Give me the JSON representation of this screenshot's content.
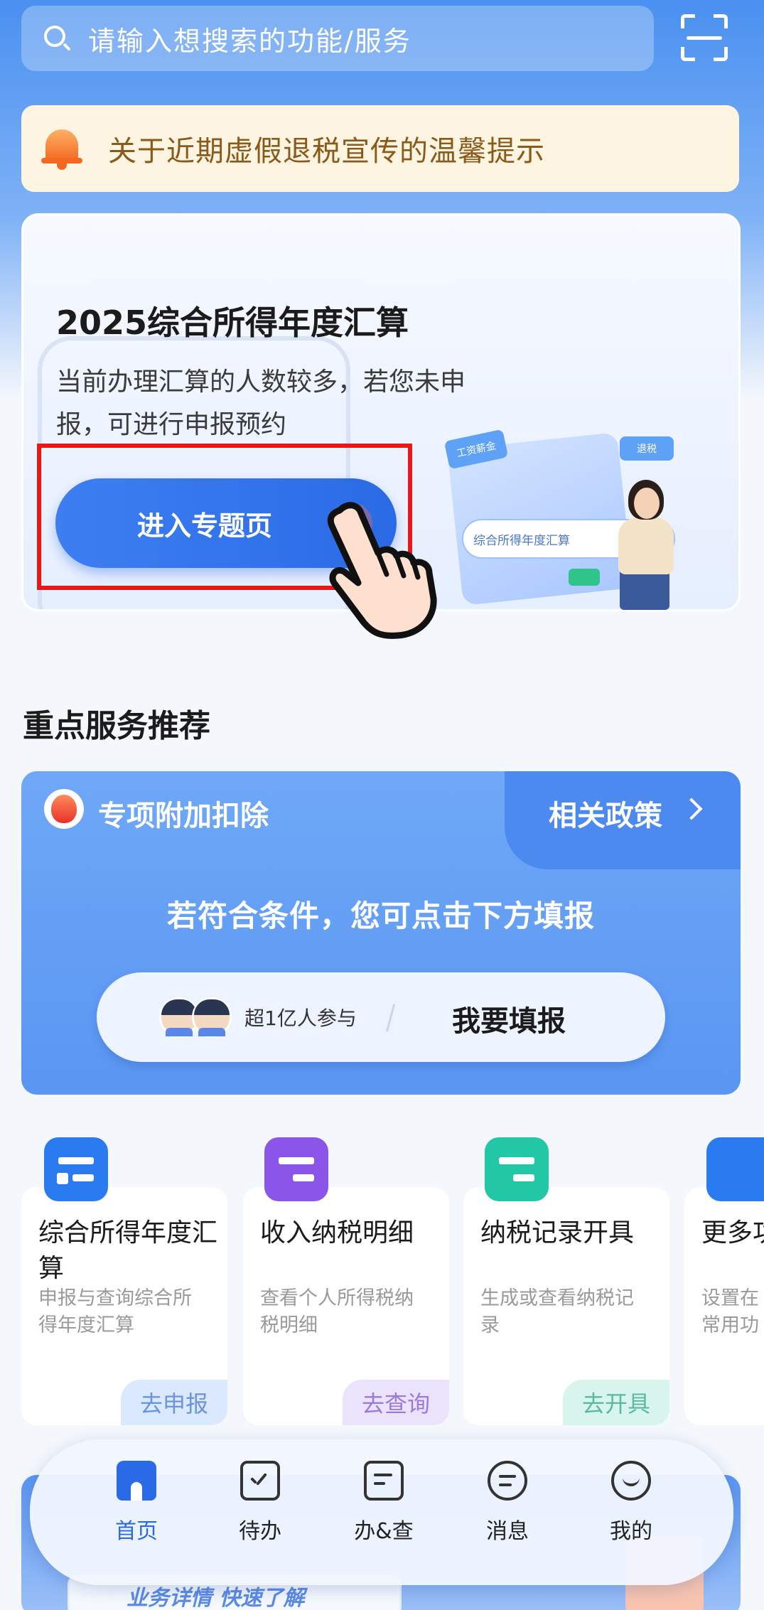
{
  "search": {
    "placeholder": "请输入想搜索的功能/服务"
  },
  "notice": {
    "text": "关于近期虚假退税宣传的温馨提示"
  },
  "feature": {
    "title": "2025综合所得年度汇算",
    "description": "当前办理汇算的人数较多，若您未申报，可进行申报预约",
    "button_label": "进入专题页",
    "illus_tag1": "工资薪金",
    "illus_tag2": "退税",
    "illus_search": "综合所得年度汇算"
  },
  "section": {
    "title": "重点服务推荐"
  },
  "recommend": {
    "title": "专项附加扣除",
    "policy_link": "相关政策",
    "hint": "若符合条件，您可点击下方填报",
    "participants": "超1亿人参与",
    "action": "我要填报"
  },
  "tiles": [
    {
      "title": "综合所得年度汇算",
      "desc": "申报与查询综合所得年度汇算",
      "action": "去申报",
      "icon": "form-icon",
      "color": "#2b7bf0",
      "action_bg": "#dbe9ff",
      "action_color": "#6b94dc"
    },
    {
      "title": "收入纳税明细",
      "desc": "查看个人所得税纳税明细",
      "action": "去查询",
      "icon": "wallet-icon",
      "color": "#8a55e8",
      "action_bg": "#ebe2fb",
      "action_color": "#9c7ad8"
    },
    {
      "title": "纳税记录开具",
      "desc": "生成或查看纳税记录",
      "action": "去开具",
      "icon": "record-icon",
      "color": "#22c7a5",
      "action_bg": "#d7f5ec",
      "action_color": "#5bb99d"
    },
    {
      "title": "更多功",
      "desc": "设置在常用功",
      "action": "",
      "icon": "grid-icon",
      "color": "#2b7bf0"
    }
  ],
  "bottom_peek": {
    "text": "业务详情 快速了解"
  },
  "nav": [
    {
      "label": "首页",
      "icon": "home-icon",
      "active": true
    },
    {
      "label": "待办",
      "icon": "calendar-check-icon",
      "active": false
    },
    {
      "label": "办&查",
      "icon": "edit-doc-icon",
      "active": false
    },
    {
      "label": "消息",
      "icon": "message-icon",
      "active": false
    },
    {
      "label": "我的",
      "icon": "smile-icon",
      "active": false
    }
  ],
  "colors": {
    "accent": "#2b6ae6",
    "highlight_box": "#e81818",
    "notice_text": "#8a5a1a"
  }
}
